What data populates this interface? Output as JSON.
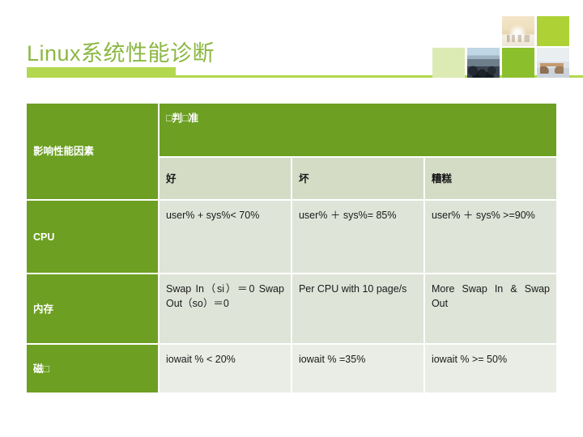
{
  "slide": {
    "title": "Linux系统性能诊断",
    "accent_color": "#8CB843",
    "bar_color": "#B3D84F",
    "table_header_green": "#6DA022",
    "subhead_gray": "#D4DCC6",
    "data_cell_gray": "#DFE4D8"
  },
  "decor": {
    "tiles": [
      {
        "name": "photo-lobby-tile",
        "kind": "photo"
      },
      {
        "name": "pale-green-tile",
        "kind": "solid",
        "color": "#DCEBB4"
      },
      {
        "name": "lime-green-tile",
        "kind": "solid",
        "color": "#AED136"
      },
      {
        "name": "photo-classroom-tile",
        "kind": "photo"
      },
      {
        "name": "green-tile",
        "kind": "solid",
        "color": "#8CBF2C"
      },
      {
        "name": "photo-office-tile",
        "kind": "photo"
      }
    ]
  },
  "table": {
    "factor_header": "影响性能因素",
    "criteria_header": "□判□准",
    "subheaders": [
      "好",
      "坏",
      "糟糕"
    ],
    "rows": [
      {
        "factor": "CPU",
        "good": "user% + sys%< 70%",
        "bad": "user% ＋ sys%= 85%",
        "ugly": "user% ＋ sys% >=90%"
      },
      {
        "factor": "内存",
        "good": "Swap In（si）＝0 Swap Out（so）＝0",
        "bad": "Per CPU with 10 page/s",
        "ugly": "More Swap In & Swap Out"
      },
      {
        "factor": "磁□",
        "good": "iowait % < 20%",
        "bad": "iowait % =35%",
        "ugly": "iowait % >= 50%"
      }
    ]
  }
}
